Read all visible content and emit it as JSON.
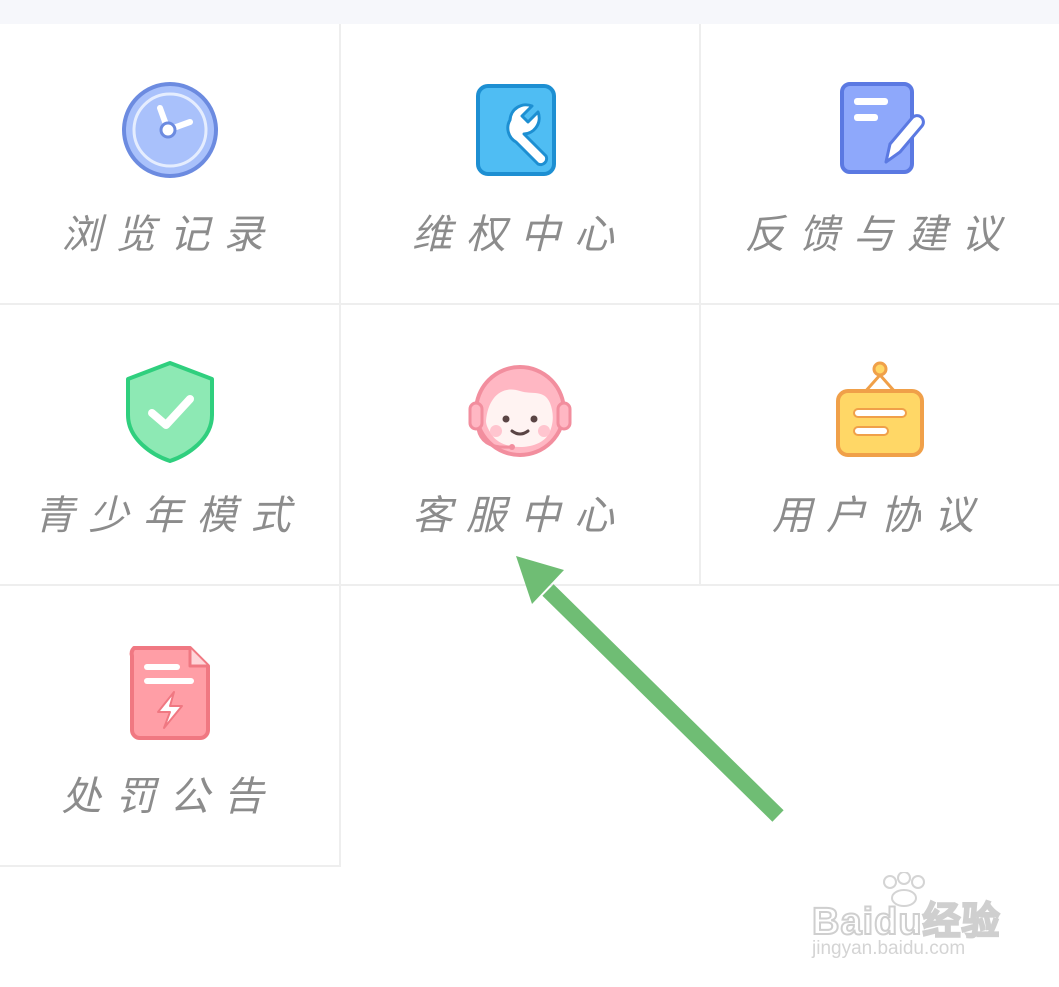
{
  "menu": {
    "items": [
      {
        "label": "浏览记录",
        "icon": "history-clock-icon"
      },
      {
        "label": "维权中心",
        "icon": "wrench-icon"
      },
      {
        "label": "反馈与建议",
        "icon": "feedback-edit-icon"
      },
      {
        "label": "青少年模式",
        "icon": "shield-check-icon"
      },
      {
        "label": "客服中心",
        "icon": "customer-service-icon"
      },
      {
        "label": "用户协议",
        "icon": "signboard-icon"
      },
      {
        "label": "处罚公告",
        "icon": "penalty-notice-icon"
      }
    ]
  },
  "watermark": {
    "logo": "Baidu经验",
    "url": "jingyan.baidu.com"
  },
  "colors": {
    "arrow": "#6fbd74",
    "label": "#8c8c8c",
    "divider": "#eeeeee"
  }
}
